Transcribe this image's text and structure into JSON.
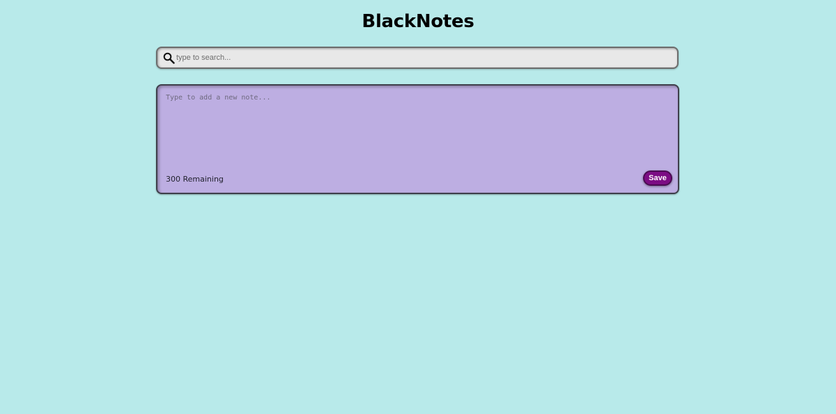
{
  "header": {
    "title": "BlackNotes"
  },
  "search": {
    "placeholder": "type to search...",
    "value": "",
    "icon": "search-icon"
  },
  "new_note": {
    "placeholder": "Type to add a new note...",
    "value": "",
    "remaining_text": "300 Remaining",
    "save_label": "Save"
  },
  "colors": {
    "page_background": "#b8eaea",
    "search_background": "#e8e8e8",
    "note_background": "#bdaee2",
    "save_button": "#7c0c84"
  }
}
